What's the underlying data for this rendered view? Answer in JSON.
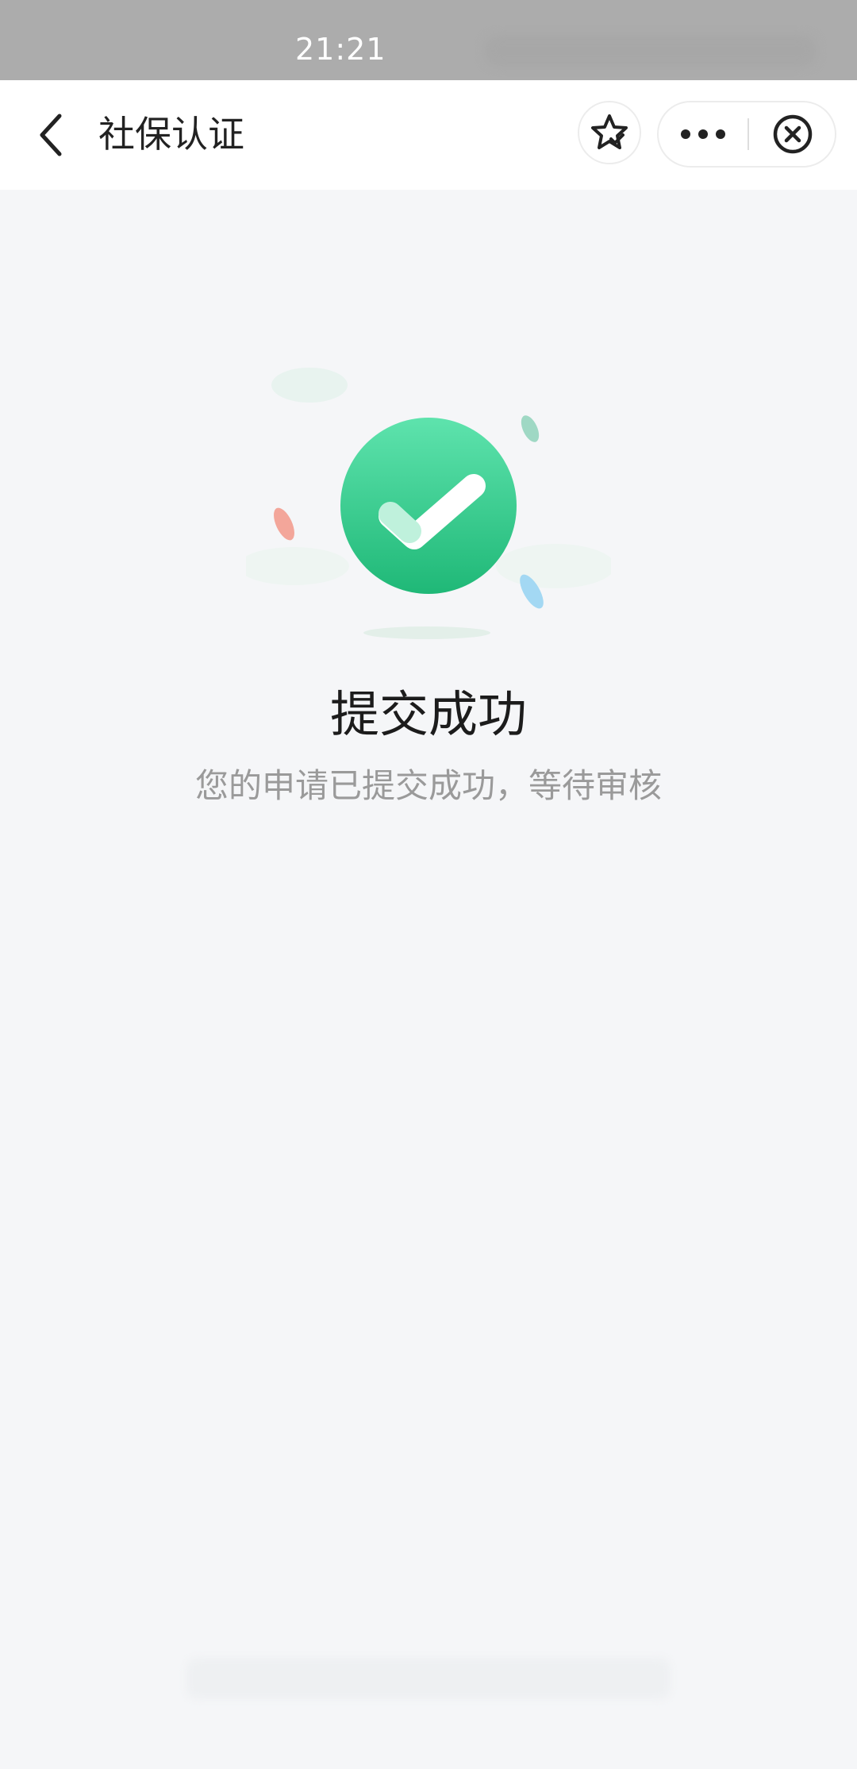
{
  "status_bar": {
    "time": "21:21"
  },
  "nav": {
    "title": "社保认证",
    "back_icon": "chevron-left-icon",
    "favorite_icon": "star-icon",
    "more_icon": "more-dots-icon",
    "close_icon": "close-circle-icon"
  },
  "result": {
    "icon": "check-circle-icon",
    "title": "提交成功",
    "description": "您的申请已提交成功，等待审核"
  },
  "colors": {
    "status_bar": "#acacac",
    "nav_bar": "#ffffff",
    "page_background": "#f5f6f8",
    "success_green": "#2cc98a",
    "title_text": "#1c1c1c",
    "desc_text": "#9a9a9a"
  }
}
